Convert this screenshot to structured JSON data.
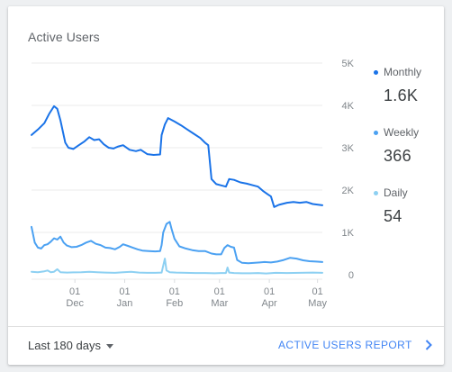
{
  "card": {
    "title": "Active Users"
  },
  "legend": [
    {
      "label": "Monthly",
      "value": "1.6K",
      "color": "#1a73e8"
    },
    {
      "label": "Weekly",
      "value": "366",
      "color": "#4ba1f2"
    },
    {
      "label": "Daily",
      "value": "54",
      "color": "#8dd0f2"
    }
  ],
  "footer": {
    "range_label": "Last 180 days",
    "report_link": "ACTIVE USERS REPORT"
  },
  "chart_data": {
    "type": "line",
    "ylim": [
      0,
      5000
    ],
    "grid": true,
    "y_ticks": [
      {
        "value": 5000,
        "label": "5K"
      },
      {
        "value": 4000,
        "label": "4K"
      },
      {
        "value": 3000,
        "label": "3K"
      },
      {
        "value": 2000,
        "label": "2K"
      },
      {
        "value": 1000,
        "label": "1K"
      },
      {
        "value": 0,
        "label": "0"
      }
    ],
    "x_range": [
      "2017-11-04",
      "2018-05-04"
    ],
    "x_ticks": [
      {
        "date": "2017-12-01",
        "day": "01",
        "month": "Dec"
      },
      {
        "date": "2018-01-01",
        "day": "01",
        "month": "Jan"
      },
      {
        "date": "2018-02-01",
        "day": "01",
        "month": "Feb"
      },
      {
        "date": "2018-03-01",
        "day": "01",
        "month": "Mar"
      },
      {
        "date": "2018-04-01",
        "day": "01",
        "month": "Apr"
      },
      {
        "date": "2018-05-01",
        "day": "01",
        "month": "May"
      }
    ],
    "series": [
      {
        "name": "Monthly",
        "color": "#1a73e8",
        "points": [
          [
            "2017-11-04",
            3300
          ],
          [
            "2017-11-08",
            3430
          ],
          [
            "2017-11-12",
            3580
          ],
          [
            "2017-11-15",
            3800
          ],
          [
            "2017-11-18",
            3980
          ],
          [
            "2017-11-20",
            3920
          ],
          [
            "2017-11-22",
            3650
          ],
          [
            "2017-11-25",
            3120
          ],
          [
            "2017-11-27",
            3000
          ],
          [
            "2017-11-30",
            2970
          ],
          [
            "2017-12-03",
            3050
          ],
          [
            "2017-12-07",
            3150
          ],
          [
            "2017-12-10",
            3250
          ],
          [
            "2017-12-13",
            3180
          ],
          [
            "2017-12-16",
            3200
          ],
          [
            "2017-12-19",
            3080
          ],
          [
            "2017-12-22",
            3000
          ],
          [
            "2017-12-25",
            2980
          ],
          [
            "2017-12-28",
            3030
          ],
          [
            "2017-12-31",
            3060
          ],
          [
            "2018-01-04",
            2950
          ],
          [
            "2018-01-08",
            2920
          ],
          [
            "2018-01-11",
            2950
          ],
          [
            "2018-01-15",
            2850
          ],
          [
            "2018-01-19",
            2830
          ],
          [
            "2018-01-23",
            2840
          ],
          [
            "2018-01-24",
            3300
          ],
          [
            "2018-01-26",
            3550
          ],
          [
            "2018-01-28",
            3700
          ],
          [
            "2018-02-01",
            3620
          ],
          [
            "2018-02-05",
            3530
          ],
          [
            "2018-02-09",
            3430
          ],
          [
            "2018-02-13",
            3330
          ],
          [
            "2018-02-17",
            3230
          ],
          [
            "2018-02-20",
            3120
          ],
          [
            "2018-02-22",
            3060
          ],
          [
            "2018-02-24",
            2260
          ],
          [
            "2018-02-27",
            2140
          ],
          [
            "2018-03-02",
            2110
          ],
          [
            "2018-03-05",
            2080
          ],
          [
            "2018-03-07",
            2260
          ],
          [
            "2018-03-10",
            2240
          ],
          [
            "2018-03-14",
            2180
          ],
          [
            "2018-03-18",
            2150
          ],
          [
            "2018-03-22",
            2110
          ],
          [
            "2018-03-25",
            2080
          ],
          [
            "2018-03-28",
            1980
          ],
          [
            "2018-03-31",
            1900
          ],
          [
            "2018-04-02",
            1850
          ],
          [
            "2018-04-04",
            1600
          ],
          [
            "2018-04-07",
            1650
          ],
          [
            "2018-04-12",
            1700
          ],
          [
            "2018-04-16",
            1720
          ],
          [
            "2018-04-20",
            1700
          ],
          [
            "2018-04-24",
            1720
          ],
          [
            "2018-04-28",
            1670
          ],
          [
            "2018-05-04",
            1640
          ]
        ]
      },
      {
        "name": "Weekly",
        "color": "#4ba1f2",
        "points": [
          [
            "2017-11-04",
            1130
          ],
          [
            "2017-11-06",
            760
          ],
          [
            "2017-11-08",
            640
          ],
          [
            "2017-11-10",
            620
          ],
          [
            "2017-11-12",
            700
          ],
          [
            "2017-11-14",
            720
          ],
          [
            "2017-11-16",
            780
          ],
          [
            "2017-11-18",
            860
          ],
          [
            "2017-11-20",
            830
          ],
          [
            "2017-11-22",
            900
          ],
          [
            "2017-11-24",
            760
          ],
          [
            "2017-11-26",
            690
          ],
          [
            "2017-11-29",
            650
          ],
          [
            "2017-12-02",
            660
          ],
          [
            "2017-12-05",
            700
          ],
          [
            "2017-12-08",
            760
          ],
          [
            "2017-12-11",
            800
          ],
          [
            "2017-12-14",
            730
          ],
          [
            "2017-12-17",
            700
          ],
          [
            "2017-12-20",
            640
          ],
          [
            "2017-12-23",
            630
          ],
          [
            "2017-12-26",
            600
          ],
          [
            "2017-12-29",
            660
          ],
          [
            "2017-12-31",
            720
          ],
          [
            "2018-01-03",
            680
          ],
          [
            "2018-01-06",
            640
          ],
          [
            "2018-01-09",
            600
          ],
          [
            "2018-01-12",
            570
          ],
          [
            "2018-01-16",
            560
          ],
          [
            "2018-01-20",
            550
          ],
          [
            "2018-01-23",
            560
          ],
          [
            "2018-01-24",
            700
          ],
          [
            "2018-01-25",
            1000
          ],
          [
            "2018-01-27",
            1200
          ],
          [
            "2018-01-29",
            1250
          ],
          [
            "2018-01-30",
            1100
          ],
          [
            "2018-02-01",
            850
          ],
          [
            "2018-02-04",
            670
          ],
          [
            "2018-02-08",
            620
          ],
          [
            "2018-02-12",
            580
          ],
          [
            "2018-02-16",
            560
          ],
          [
            "2018-02-20",
            560
          ],
          [
            "2018-02-24",
            500
          ],
          [
            "2018-02-27",
            480
          ],
          [
            "2018-03-02",
            480
          ],
          [
            "2018-03-04",
            630
          ],
          [
            "2018-03-06",
            700
          ],
          [
            "2018-03-08",
            660
          ],
          [
            "2018-03-10",
            640
          ],
          [
            "2018-03-12",
            350
          ],
          [
            "2018-03-15",
            280
          ],
          [
            "2018-03-19",
            270
          ],
          [
            "2018-03-23",
            280
          ],
          [
            "2018-03-26",
            290
          ],
          [
            "2018-03-29",
            300
          ],
          [
            "2018-04-02",
            290
          ],
          [
            "2018-04-06",
            310
          ],
          [
            "2018-04-10",
            350
          ],
          [
            "2018-04-14",
            400
          ],
          [
            "2018-04-18",
            380
          ],
          [
            "2018-04-22",
            340
          ],
          [
            "2018-04-26",
            320
          ],
          [
            "2018-04-30",
            310
          ],
          [
            "2018-05-04",
            300
          ]
        ]
      },
      {
        "name": "Daily",
        "color": "#8dd0f2",
        "points": [
          [
            "2017-11-04",
            70
          ],
          [
            "2017-11-08",
            60
          ],
          [
            "2017-11-12",
            80
          ],
          [
            "2017-11-14",
            100
          ],
          [
            "2017-11-16",
            60
          ],
          [
            "2017-11-18",
            70
          ],
          [
            "2017-11-20",
            130
          ],
          [
            "2017-11-22",
            60
          ],
          [
            "2017-11-26",
            50
          ],
          [
            "2017-11-30",
            55
          ],
          [
            "2017-12-05",
            60
          ],
          [
            "2017-12-10",
            70
          ],
          [
            "2017-12-15",
            60
          ],
          [
            "2017-12-20",
            50
          ],
          [
            "2017-12-26",
            45
          ],
          [
            "2017-12-31",
            60
          ],
          [
            "2018-01-05",
            70
          ],
          [
            "2018-01-10",
            50
          ],
          [
            "2018-01-15",
            45
          ],
          [
            "2018-01-20",
            45
          ],
          [
            "2018-01-24",
            50
          ],
          [
            "2018-01-26",
            380
          ],
          [
            "2018-01-27",
            100
          ],
          [
            "2018-01-29",
            60
          ],
          [
            "2018-02-02",
            50
          ],
          [
            "2018-02-08",
            45
          ],
          [
            "2018-02-14",
            40
          ],
          [
            "2018-02-20",
            40
          ],
          [
            "2018-02-26",
            35
          ],
          [
            "2018-03-02",
            40
          ],
          [
            "2018-03-05",
            40
          ],
          [
            "2018-03-06",
            170
          ],
          [
            "2018-03-07",
            50
          ],
          [
            "2018-03-10",
            40
          ],
          [
            "2018-03-15",
            35
          ],
          [
            "2018-03-20",
            35
          ],
          [
            "2018-03-25",
            40
          ],
          [
            "2018-03-30",
            30
          ],
          [
            "2018-04-05",
            45
          ],
          [
            "2018-04-12",
            40
          ],
          [
            "2018-04-20",
            45
          ],
          [
            "2018-04-28",
            50
          ],
          [
            "2018-05-04",
            45
          ]
        ]
      }
    ]
  }
}
